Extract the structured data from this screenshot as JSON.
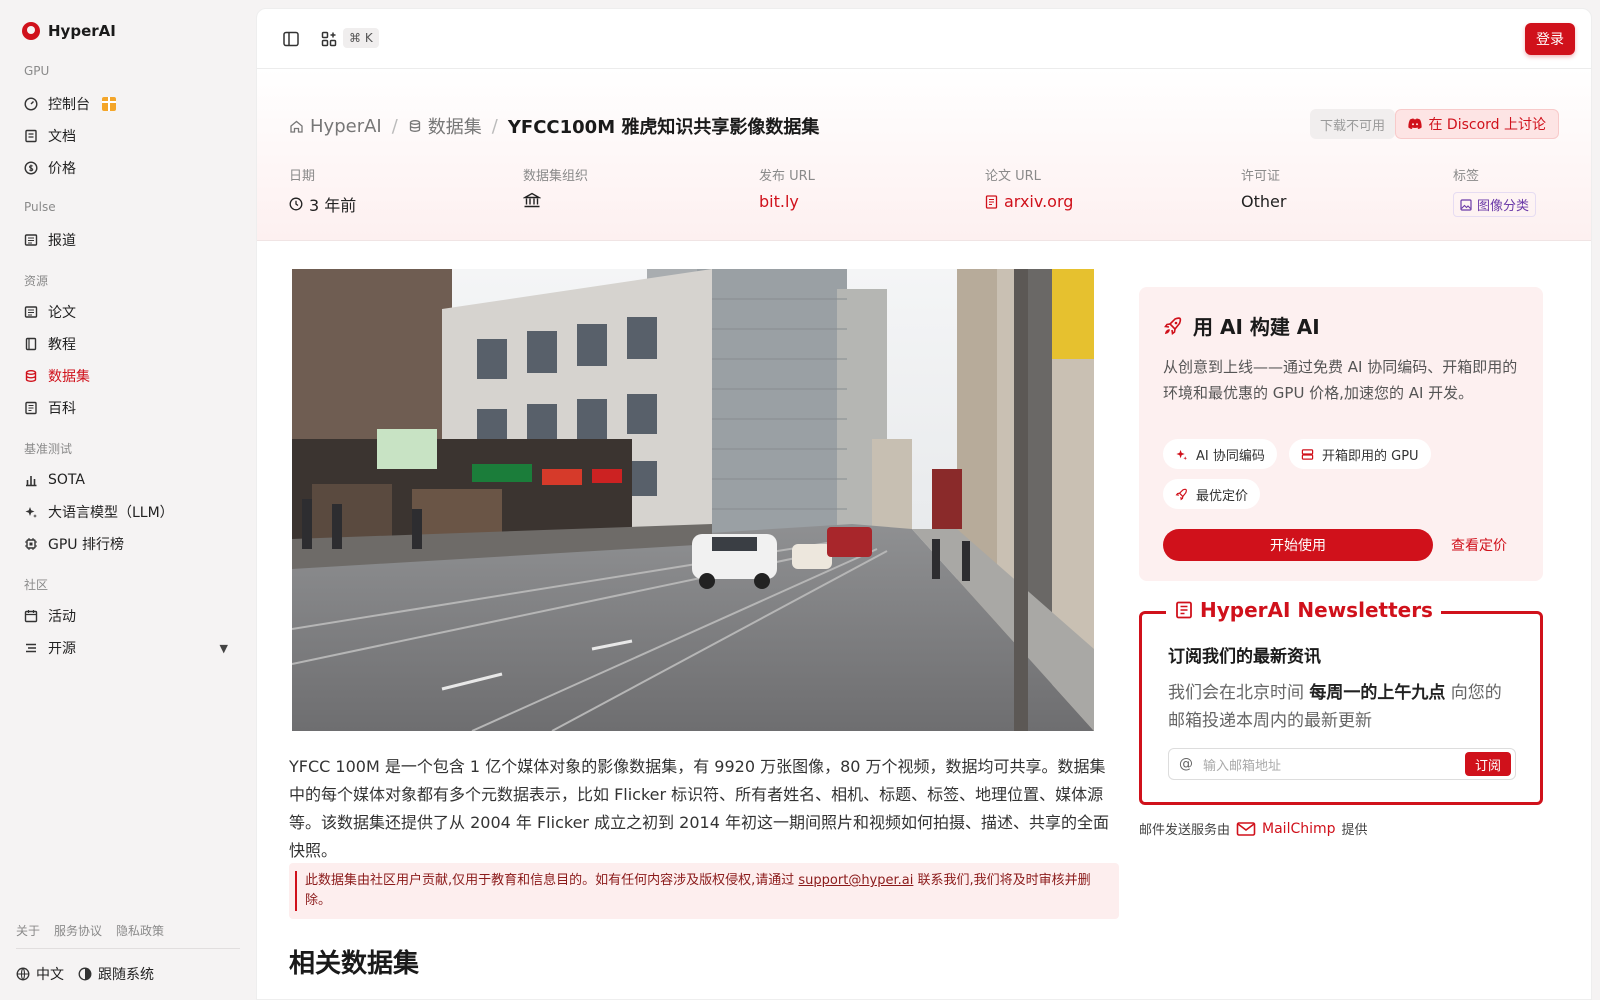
{
  "brand": {
    "name": "HyperAI"
  },
  "sidebar": {
    "sections": [
      {
        "title": "GPU",
        "items": [
          {
            "label": "控制台",
            "icon": "gauge-icon"
          },
          {
            "label": "文档",
            "icon": "book-icon"
          },
          {
            "label": "价格",
            "icon": "dollar-icon"
          }
        ]
      },
      {
        "title": "Pulse",
        "items": [
          {
            "label": "报道",
            "icon": "newspaper-icon"
          }
        ]
      },
      {
        "title": "资源",
        "items": [
          {
            "label": "论文",
            "icon": "newspaper-icon"
          },
          {
            "label": "教程",
            "icon": "notebook-icon"
          },
          {
            "label": "数据集",
            "icon": "database-icon"
          },
          {
            "label": "百科",
            "icon": "book-open-icon"
          }
        ]
      },
      {
        "title": "基准测试",
        "items": [
          {
            "label": "SOTA",
            "icon": "chart-icon"
          },
          {
            "label": "大语言模型（LLM）",
            "icon": "sparkles-icon"
          },
          {
            "label": "GPU 排行榜",
            "icon": "cpu-icon"
          }
        ]
      },
      {
        "title": "社区",
        "items": [
          {
            "label": "活动",
            "icon": "calendar-icon"
          },
          {
            "label": "开源",
            "icon": "list-icon"
          }
        ]
      }
    ],
    "active_item": "数据集",
    "footer_links": [
      "关于",
      "服务协议",
      "隐私政策"
    ],
    "language": "中文",
    "theme": "跟随系统"
  },
  "topbar": {
    "shortcut": "⌘ K",
    "login_label": "登录"
  },
  "breadcrumb": {
    "home": "HyperAI",
    "section": "数据集",
    "current": "YFCC100M 雅虎知识共享影像数据集"
  },
  "actions": {
    "download_label": "下载不可用",
    "discord_label": "在 Discord 上讨论"
  },
  "meta": {
    "date_label": "日期",
    "date_value": "3 年前",
    "org_label": "数据集组织",
    "release_url_label": "发布 URL",
    "release_url_value": "bit.ly",
    "paper_url_label": "论文 URL",
    "paper_url_value": "arxiv.org",
    "license_label": "许可证",
    "license_value": "Other",
    "tags_label": "标签",
    "tag_value": "图像分类"
  },
  "description": "YFCC 100M 是一个包含 1 亿个媒体对象的影像数据集，有 9920 万张图像，80 万个视频，数据均可共享。数据集中的每个媒体对象都有多个元数据表示，比如 Flicker 标识符、所有者姓名、相机、标题、标签、地理位置、媒体源等。该数据集还提供了从 2004 年 Flicker 成立之初到 2014 年初这一期间照片和视频如何拍摄、描述、共享的全面快照。",
  "notice": {
    "text_before": "此数据集由社区用户贡献,仅用于教育和信息目的。如有任何内容涉及版权侵权,请通过 ",
    "email": "support@hyper.ai",
    "text_after": " 联系我们,我们将及时审核并删除。"
  },
  "related_title": "相关数据集",
  "ai_card": {
    "title": "用 AI 构建 AI",
    "text": "从创意到上线——通过免费 AI 协同编码、开箱即用的环境和最优惠的 GPU 价格,加速您的 AI 开发。",
    "pills": [
      "AI 协同编码",
      "开箱即用的 GPU",
      "最优定价"
    ],
    "start_label": "开始使用",
    "pricing_label": "查看定价"
  },
  "newsletter": {
    "legend": "HyperAI Newsletters",
    "title": "订阅我们的最新资讯",
    "text_before": "我们会在北京时间 ",
    "text_bold": "每周一的上午九点",
    "text_after": " 向您的邮箱投递本周内的最新更新",
    "placeholder": "输入邮箱地址",
    "subscribe_label": "订阅",
    "by_prefix": "邮件发送服务由",
    "provider": "MailChimp",
    "by_suffix": "提供"
  },
  "colors": {
    "accent": "#d0111b",
    "sidebar_bg": "#f5f3f3",
    "hero_tint": "#fdf0f0"
  }
}
